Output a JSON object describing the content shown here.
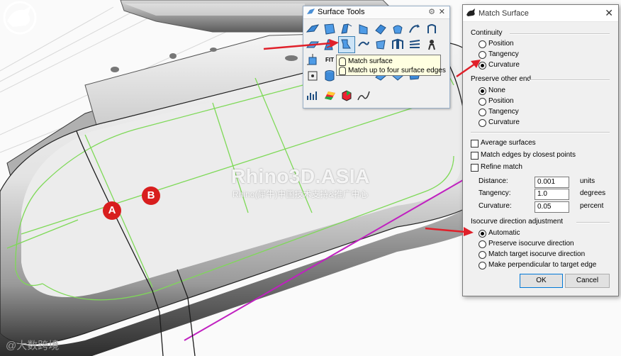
{
  "viewport": {
    "watermark_title": "Rhino3D.ASIA",
    "watermark_subtitle": "Rhino(犀牛)中国技术支持&推广中心",
    "points": [
      {
        "label": "A"
      },
      {
        "label": "B"
      }
    ],
    "corner_watermark": "@大数跨境"
  },
  "toolbar": {
    "title": "Surface Tools",
    "gear_glyph": "⚙",
    "close_glyph": "✕",
    "fit_label": "FIT",
    "tooltip": {
      "line1": "Match surface",
      "line2": "Match up to four surface edges"
    }
  },
  "dialog": {
    "title": "Match Surface",
    "close_glyph": "✕",
    "continuity": {
      "label": "Continuity",
      "options": [
        "Position",
        "Tangency",
        "Curvature"
      ],
      "selected": "Curvature"
    },
    "preserve_other_end": {
      "label": "Preserve other end",
      "options": [
        "None",
        "Position",
        "Tangency",
        "Curvature"
      ],
      "selected": "None"
    },
    "checkboxes": {
      "average_surfaces": "Average surfaces",
      "match_edges": "Match edges by closest points",
      "refine_match": "Refine match"
    },
    "fields": {
      "distance": {
        "label": "Distance:",
        "value": "0.001",
        "unit": "units"
      },
      "tangency": {
        "label": "Tangency:",
        "value": "1.0",
        "unit": "degrees"
      },
      "curvature": {
        "label": "Curvature:",
        "value": "0.05",
        "unit": "percent"
      }
    },
    "isocurve": {
      "label": "Isocurve direction adjustment",
      "options": [
        "Automatic",
        "Preserve isocurve direction",
        "Match target isocurve direction",
        "Make perpendicular to target edge"
      ],
      "selected": "Automatic"
    },
    "ok_label": "OK",
    "cancel_label": "Cancel"
  },
  "colors": {
    "arrow": "#e0202a",
    "point_badge": "#d81e1e",
    "edge_green": "#7ed957"
  }
}
